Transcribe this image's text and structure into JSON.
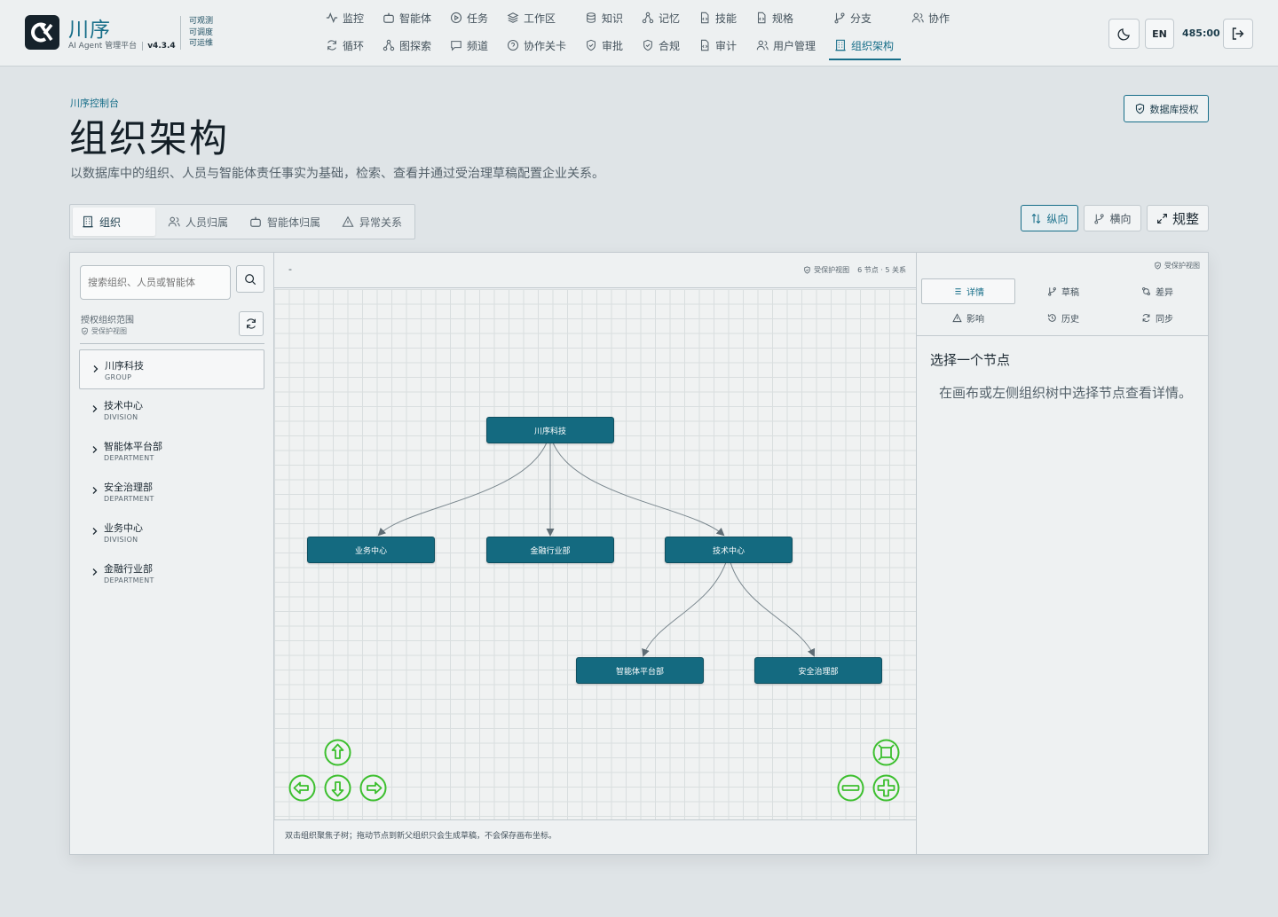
{
  "brand": {
    "name": "川序",
    "subtitle": "AI Agent 管理平台",
    "version": "v4.3.4",
    "tags": [
      "可观测",
      "可调度",
      "可运维"
    ]
  },
  "nav": {
    "row1": [
      {
        "label": "监控",
        "icon": "activity-icon"
      },
      {
        "label": "智能体",
        "icon": "bot-icon"
      },
      {
        "label": "任务",
        "icon": "play-circle-icon"
      },
      {
        "label": "工作区",
        "icon": "layers-icon"
      },
      {
        "label": "知识",
        "icon": "database-icon"
      },
      {
        "label": "记忆",
        "icon": "network-icon"
      },
      {
        "label": "技能",
        "icon": "file-code-icon"
      },
      {
        "label": "规格",
        "icon": "file-code-icon"
      },
      {
        "label": "分支",
        "icon": "git-branch-icon"
      },
      {
        "label": "协作",
        "icon": "users-icon"
      }
    ],
    "row2": [
      {
        "label": "循环",
        "icon": "refresh-icon"
      },
      {
        "label": "图探索",
        "icon": "network-icon"
      },
      {
        "label": "频道",
        "icon": "message-icon"
      },
      {
        "label": "协作关卡",
        "icon": "help-circle-icon"
      },
      {
        "label": "审批",
        "icon": "shield-check-icon"
      },
      {
        "label": "合规",
        "icon": "shield-check-icon"
      },
      {
        "label": "审计",
        "icon": "file-code-icon"
      },
      {
        "label": "用户管理",
        "icon": "users-icon"
      },
      {
        "label": "组织架构",
        "icon": "building-icon",
        "active": true
      }
    ]
  },
  "header_controls": {
    "theme_icon": "moon-icon",
    "lang_label": "EN",
    "clock": "485:00",
    "logout_icon": "logout-icon"
  },
  "page": {
    "breadcrumb": "川序控制台",
    "title": "组织架构",
    "description": "以数据库中的组织、人员与智能体责任事实为基础，检索、查看并通过受治理草稿配置企业关系。",
    "db_auth_label": "数据库授权"
  },
  "tabs": [
    {
      "label": "组织",
      "icon": "building-icon",
      "active": true
    },
    {
      "label": "人员归属",
      "icon": "users-icon"
    },
    {
      "label": "智能体归属",
      "icon": "bot-icon"
    },
    {
      "label": "异常关系",
      "icon": "alert-triangle-icon"
    }
  ],
  "view_buttons": {
    "vertical": "纵向",
    "horizontal": "横向",
    "fit": "规整"
  },
  "sidebar": {
    "search_placeholder": "搜索组织、人员或智能体",
    "scope_label": "授权组织范围",
    "protected_label": "受保护视图",
    "tree": [
      {
        "name": "川序科技",
        "type": "GROUP",
        "selected": true
      },
      {
        "name": "技术中心",
        "type": "DIVISION"
      },
      {
        "name": "智能体平台部",
        "type": "DEPARTMENT"
      },
      {
        "name": "安全治理部",
        "type": "DEPARTMENT"
      },
      {
        "name": "业务中心",
        "type": "DIVISION"
      },
      {
        "name": "金融行业部",
        "type": "DEPARTMENT"
      }
    ]
  },
  "canvas": {
    "header_text": "-",
    "protected_label": "受保护视图",
    "stats": "6 节点 · 5 关系",
    "nodes": {
      "root": "川序科技",
      "business": "业务中心",
      "finance": "金融行业部",
      "tech": "技术中心",
      "agent_platform": "智能体平台部",
      "security": "安全治理部"
    },
    "footer": "双击组织聚焦子树；拖动节点到新父组织只会生成草稿，不会保存画布坐标。"
  },
  "detail": {
    "protected_label": "受保护视图",
    "tabs": [
      {
        "label": "详情",
        "icon": "list-icon",
        "active": true
      },
      {
        "label": "草稿",
        "icon": "git-branch-icon"
      },
      {
        "label": "差异",
        "icon": "diff-icon"
      },
      {
        "label": "影响",
        "icon": "alert-triangle-icon"
      },
      {
        "label": "历史",
        "icon": "history-icon"
      },
      {
        "label": "同步",
        "icon": "refresh-icon"
      }
    ],
    "empty_title": "选择一个节点",
    "empty_hint": "在画布或左侧组织树中选择节点查看详情。"
  },
  "colors": {
    "accent": "#176e89",
    "node_fill": "#146a80",
    "control_green": "#3cbf2e"
  }
}
